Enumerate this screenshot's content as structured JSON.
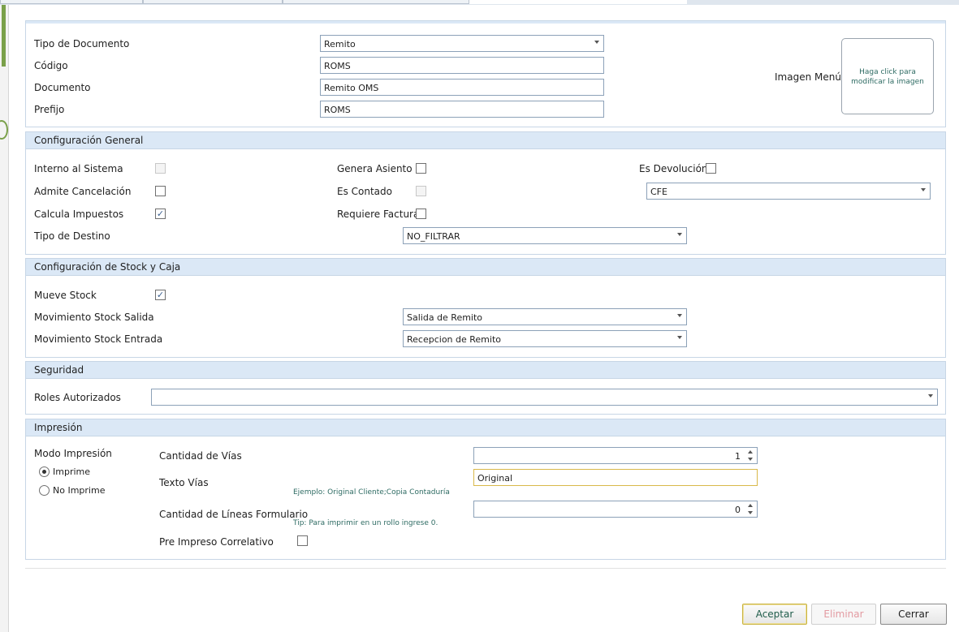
{
  "header": {
    "tipo_documento_label": "Tipo de Documento",
    "tipo_documento_value": "Remito",
    "codigo_label": "Código",
    "codigo_value": "ROMS",
    "documento_label": "Documento",
    "documento_value": "Remito OMS",
    "prefijo_label": "Prefijo",
    "prefijo_value": "ROMS",
    "imagen_menu_label": "Imagen Menú",
    "imagen_hint": "Haga click para modificar la imagen"
  },
  "general": {
    "title": "Configuración General",
    "interno_label": "Interno al Sistema",
    "interno_checked": false,
    "admite_label": "Admite Cancelación",
    "admite_checked": false,
    "calcula_label": "Calcula Impuestos",
    "calcula_checked": true,
    "tipo_destino_label": "Tipo de Destino",
    "tipo_destino_value": "NO_FILTRAR",
    "genera_label": "Genera Asiento",
    "genera_checked": false,
    "contado_label": "Es Contado",
    "contado_checked": false,
    "requiere_label": "Requiere Factura",
    "requiere_checked": false,
    "devolucion_label": "Es Devolución",
    "devolucion_checked": false,
    "cfe_value": "CFE"
  },
  "stock": {
    "title": "Configuración de Stock y Caja",
    "mueve_label": "Mueve Stock",
    "mueve_checked": true,
    "salida_label": "Movimiento Stock Salida",
    "salida_value": "Salida de Remito",
    "entrada_label": "Movimiento Stock Entrada",
    "entrada_value": "Recepcion de Remito"
  },
  "seguridad": {
    "title": "Seguridad",
    "roles_label": "Roles Autorizados",
    "roles_value": ""
  },
  "impresion": {
    "title": "Impresión",
    "modo_label": "Modo Impresión",
    "imprime_label": "Imprime",
    "no_imprime_label": "No Imprime",
    "selected_mode": "Imprime",
    "vias_label": "Cantidad de Vías",
    "vias_value": "1",
    "texto_vias_label": "Texto Vías",
    "texto_vias_value": "Original",
    "texto_vias_hint": "Ejemplo: Original Cliente;Copia Contaduría",
    "lineas_label": "Cantidad de Líneas Formulario",
    "lineas_value": "0",
    "lineas_hint": "Tip: Para imprimir en un rollo ingrese 0.",
    "preimpreso_label": "Pre Impreso Correlativo",
    "preimpreso_checked": false
  },
  "buttons": {
    "aceptar": "Aceptar",
    "eliminar": "Eliminar",
    "cerrar": "Cerrar"
  },
  "check_mark": "✓"
}
